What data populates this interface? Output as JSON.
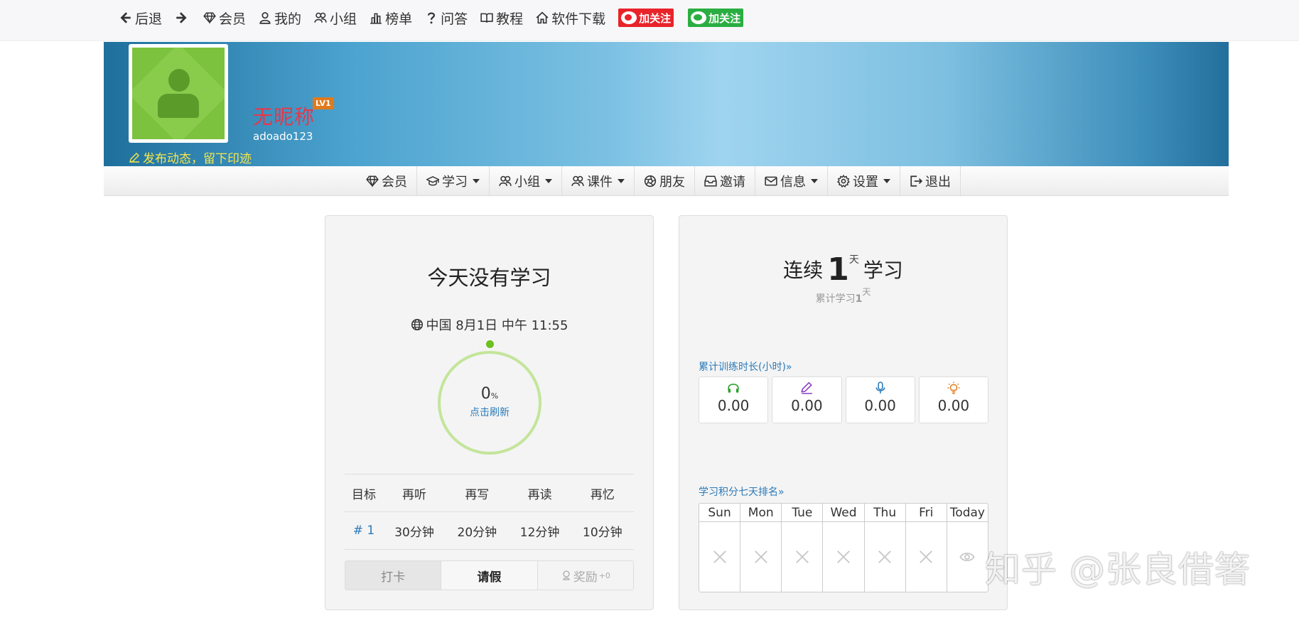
{
  "topnav": {
    "back": "后退",
    "members": "会员",
    "mine": "我的",
    "groups": "小组",
    "rankings": "榜单",
    "qa": "问答",
    "tutorials": "教程",
    "download": "软件下载",
    "follow_weibo": "加关注",
    "follow_wechat": "加关注"
  },
  "profile": {
    "nickname": "无昵称",
    "level": "LV1",
    "username": "adoado123",
    "post_prompt": "发布动态，留下印迹"
  },
  "mainnav": [
    {
      "label": "会员"
    },
    {
      "label": "学习"
    },
    {
      "label": "小组"
    },
    {
      "label": "课件"
    },
    {
      "label": "朋友"
    },
    {
      "label": "邀请"
    },
    {
      "label": "信息"
    },
    {
      "label": "设置"
    },
    {
      "label": "退出"
    }
  ],
  "today": {
    "title": "今天没有学习",
    "datetime": "中国 8月1日 中午 11:55",
    "progress_value": "0",
    "progress_unit": "%",
    "refresh": "点击刷新"
  },
  "goals": {
    "headers": [
      "目标",
      "再听",
      "再写",
      "再读",
      "再忆"
    ],
    "row": [
      "# 1",
      "30分钟",
      "20分钟",
      "12分钟",
      "10分钟"
    ]
  },
  "actions": {
    "checkin": "打卡",
    "leave": "请假",
    "reward": "奖励",
    "reward_count": "+0"
  },
  "streak": {
    "prefix": "连续",
    "days": "1",
    "unit": "天",
    "suffix": "学习",
    "total_label": "累计学习",
    "total_days": "1",
    "total_unit": "天"
  },
  "training": {
    "link": "累计训练时长(小时)»",
    "stats": [
      {
        "icon": "headphones-icon",
        "value": "0.00",
        "color": "#2aa12a"
      },
      {
        "icon": "pencil-icon",
        "value": "0.00",
        "color": "#8a3fc0"
      },
      {
        "icon": "microphone-icon",
        "value": "0.00",
        "color": "#2a7ab8"
      },
      {
        "icon": "lightbulb-icon",
        "value": "0.00",
        "color": "#e07a1c"
      }
    ]
  },
  "ranking": {
    "link": "学习积分七天排名»",
    "days": [
      "Sun",
      "Mon",
      "Tue",
      "Wed",
      "Thu",
      "Fri",
      "Today"
    ]
  },
  "watermark": "知乎 @张良借箸"
}
